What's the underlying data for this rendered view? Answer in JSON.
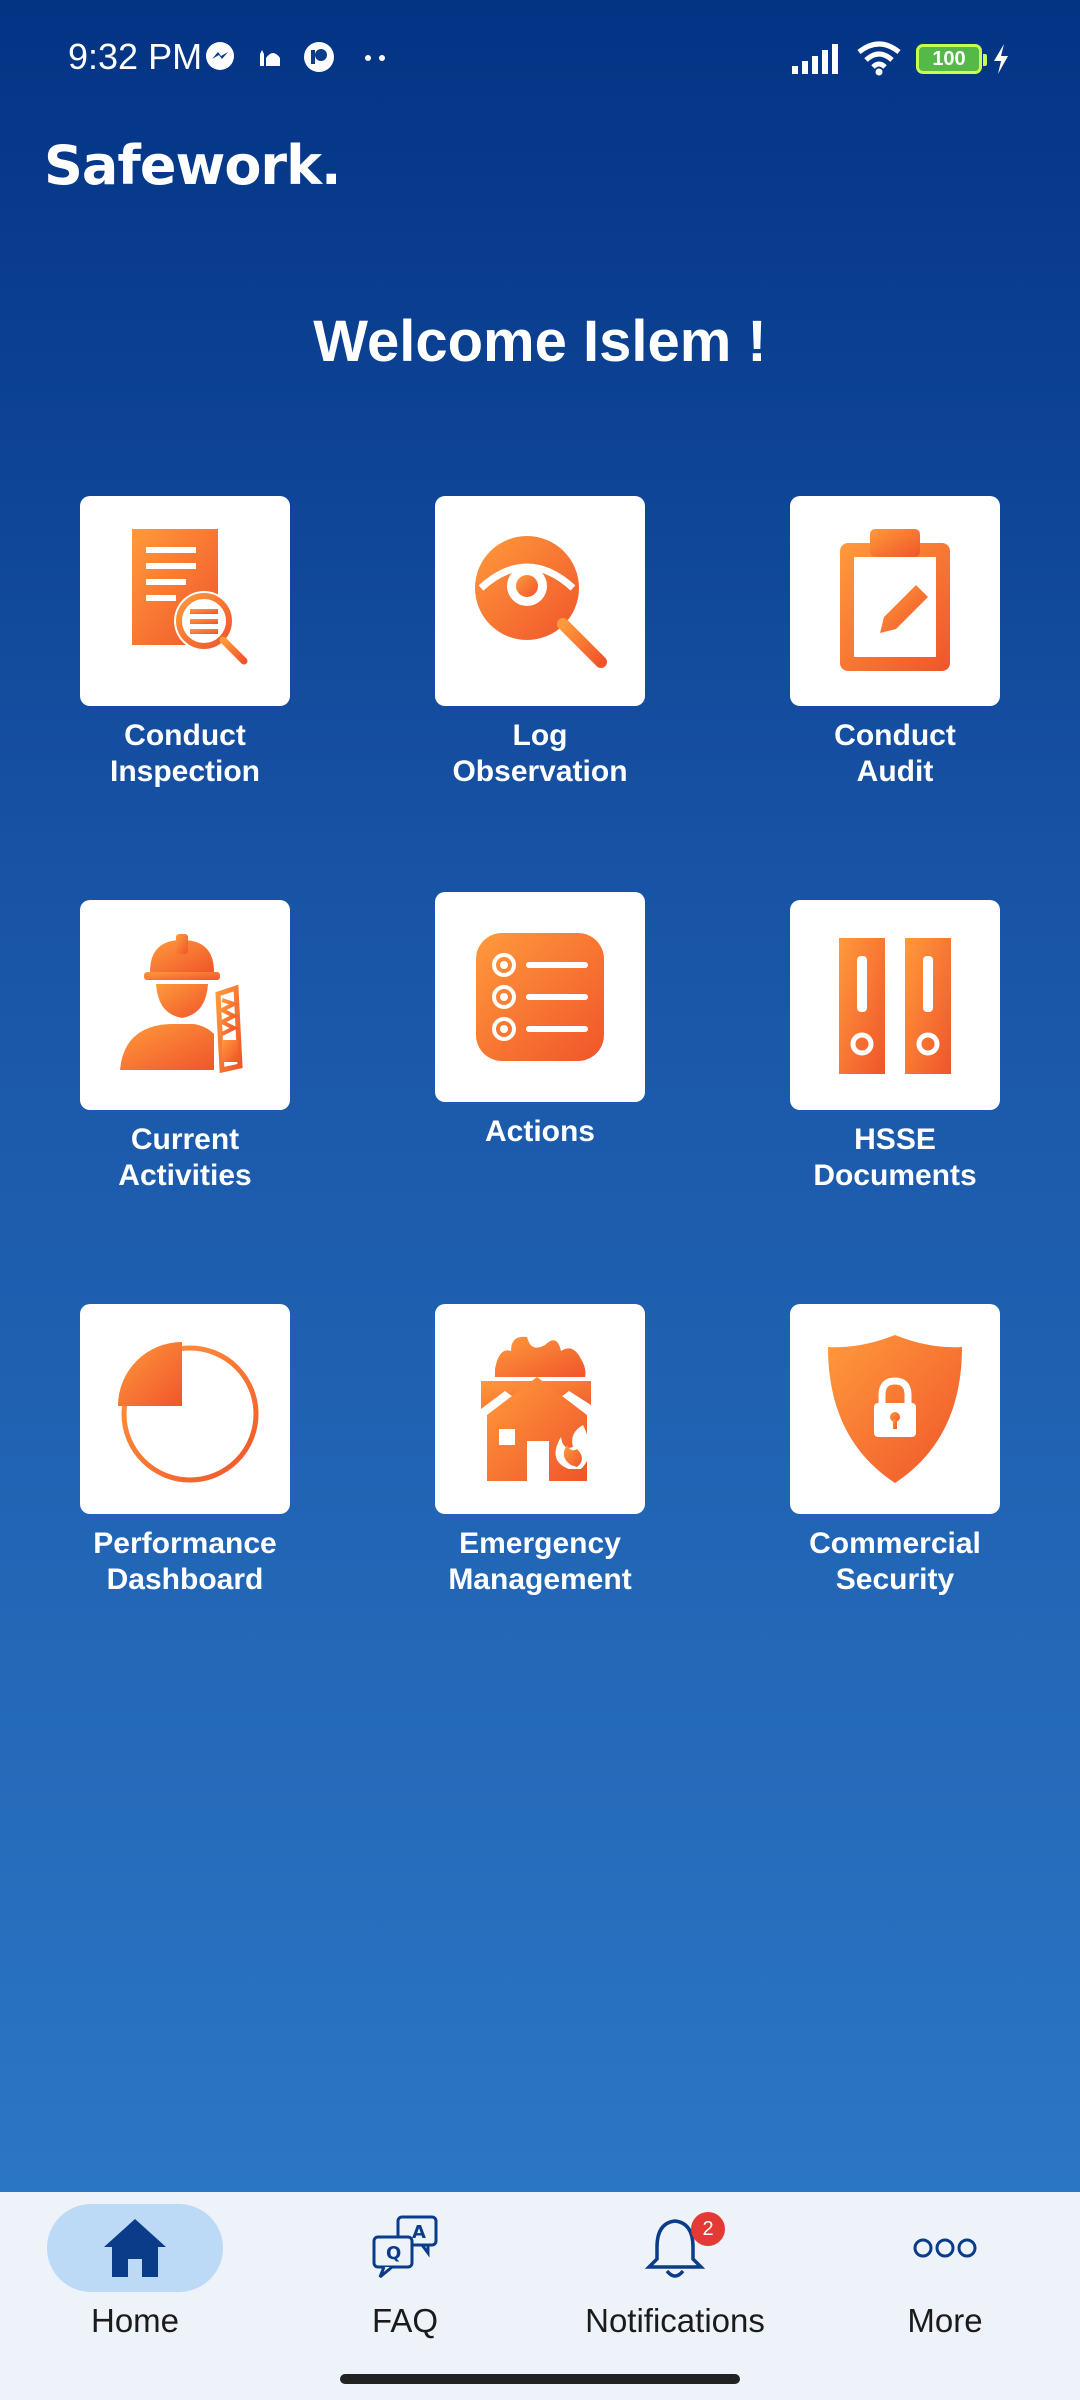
{
  "status_bar": {
    "time": "9:32 PM",
    "battery": "100",
    "icons": [
      "messenger-icon",
      "mosque-icon",
      "app-icon",
      "more-dots-icon",
      "signal-icon",
      "wifi-icon",
      "battery-icon",
      "charging-icon"
    ]
  },
  "brand": "Safework.",
  "welcome": "Welcome Islem !",
  "colors": {
    "accent_orange": "#f26b2a",
    "accent_orange_light": "#ff9a3c",
    "background_top": "#033384",
    "background_bottom": "#2e7bc9",
    "nav_active": "#bcd9f6",
    "badge": "#e53935"
  },
  "tiles": [
    {
      "label": "Conduct\nInspection",
      "icon": "document-search-icon"
    },
    {
      "label": "Log\nObservation",
      "icon": "eye-search-icon"
    },
    {
      "label": "Conduct\nAudit",
      "icon": "clipboard-edit-icon"
    },
    {
      "label": "Current\nActivities",
      "icon": "worker-saw-icon"
    },
    {
      "label": "Actions",
      "icon": "checklist-icon"
    },
    {
      "label": "HSSE\nDocuments",
      "icon": "binders-icon"
    },
    {
      "label": "Performance\nDashboard",
      "icon": "pie-chart-icon"
    },
    {
      "label": "Emergency\nManagement",
      "icon": "house-fire-icon"
    },
    {
      "label": "Commercial\nSecurity",
      "icon": "shield-lock-icon"
    }
  ],
  "bottom_nav": [
    {
      "label": "Home",
      "icon": "home-icon",
      "active": true
    },
    {
      "label": "FAQ",
      "icon": "faq-icon",
      "active": false
    },
    {
      "label": "Notifications",
      "icon": "bell-icon",
      "active": false,
      "badge": "2"
    },
    {
      "label": "More",
      "icon": "more-icon",
      "active": false
    }
  ]
}
